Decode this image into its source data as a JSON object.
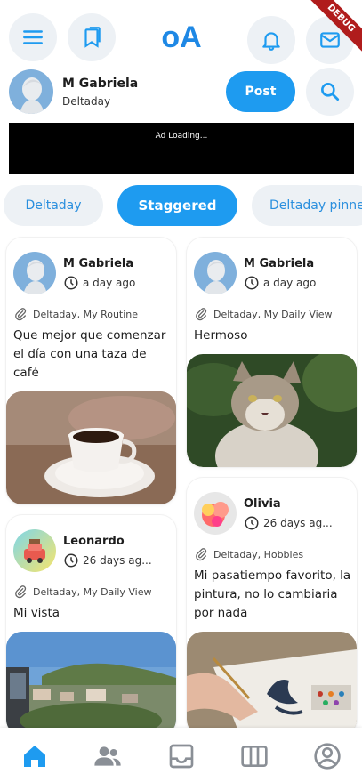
{
  "header": {
    "logo": "oA",
    "debug_banner": "DEBUG",
    "menu_icon": "menu-icon",
    "bookmarks_icon": "bookmarks-icon",
    "notifications_icon": "bell-icon",
    "messages_icon": "mail-icon",
    "search_icon": "search-icon"
  },
  "profile": {
    "name": "M Gabriela",
    "subtitle": "Deltaday",
    "post_label": "Post"
  },
  "ad": {
    "text": "Ad Loading..."
  },
  "tabs": [
    {
      "label": "Deltaday",
      "active": false
    },
    {
      "label": "Staggered",
      "active": true
    },
    {
      "label": "Deltaday pinned",
      "active": false
    }
  ],
  "posts": [
    {
      "author": "M Gabriela",
      "time": "a day ago",
      "tags": "Deltaday, My Routine",
      "text": "Que mejor que comenzar el día con una taza de café",
      "image": "coffee-cup"
    },
    {
      "author": "M Gabriela",
      "time": "a day ago",
      "tags": "Deltaday, My Daily View",
      "text": "Hermoso",
      "image": "cat"
    },
    {
      "author": "Leonardo",
      "time": "26 days ag...",
      "tags": "Deltaday, My Daily View",
      "text": "Mi vista",
      "image": "town-view"
    },
    {
      "author": "Olivia",
      "time": "26 days ag...",
      "tags": "Deltaday, Hobbies",
      "text": "Mi pasatiempo favorito, la pintura, no lo cambiaria por nada",
      "image": "painting"
    }
  ],
  "bottom_nav": [
    {
      "icon": "home-icon",
      "active": true
    },
    {
      "icon": "people-icon",
      "active": false
    },
    {
      "icon": "inbox-icon",
      "active": false
    },
    {
      "icon": "columns-icon",
      "active": false
    },
    {
      "icon": "account-icon",
      "active": false
    }
  ],
  "colors": {
    "accent": "#1e9bf0",
    "logo": "#1e88e5",
    "chip_bg": "#edf1f5",
    "debug": "#b01c1c"
  }
}
